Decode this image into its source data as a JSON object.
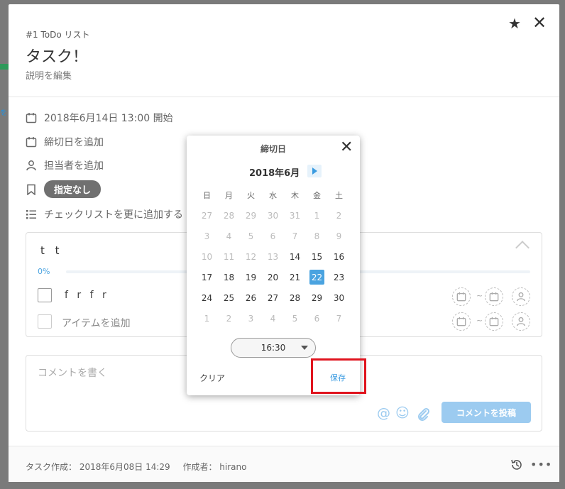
{
  "header": {
    "breadcrumb": "#1 ToDo リスト",
    "title": "タスク！",
    "description": "説明を編集"
  },
  "details": {
    "start": "2018年6月14日 13:00 開始",
    "due": "締切日を追加",
    "assignee": "担当者を追加",
    "label": "指定なし",
    "checklist_add": "チェックリストを更に追加する"
  },
  "checklist": {
    "title": "t t",
    "progress_text": "0%",
    "progress": 0,
    "items": [
      {
        "text": "f r f r"
      }
    ],
    "add_item": "アイテムを追加",
    "tilde": "~"
  },
  "comment": {
    "placeholder": "コメントを書く",
    "post_button": "コメントを投稿"
  },
  "footer": {
    "created": "タスク作成： 2018年6月08日 14:29",
    "author": "作成者： hirano"
  },
  "datepicker": {
    "title": "締切日",
    "month": "2018年6月",
    "weekdays": [
      "日",
      "月",
      "火",
      "水",
      "木",
      "金",
      "土"
    ],
    "weeks": [
      [
        [
          "27",
          0
        ],
        [
          "28",
          0
        ],
        [
          "29",
          0
        ],
        [
          "30",
          0
        ],
        [
          "31",
          0
        ],
        [
          "1",
          0
        ],
        [
          "2",
          0
        ]
      ],
      [
        [
          "3",
          0
        ],
        [
          "4",
          0
        ],
        [
          "5",
          0
        ],
        [
          "6",
          0
        ],
        [
          "7",
          0
        ],
        [
          "8",
          0
        ],
        [
          "9",
          0
        ]
      ],
      [
        [
          "10",
          0
        ],
        [
          "11",
          0
        ],
        [
          "12",
          0
        ],
        [
          "13",
          0
        ],
        [
          "14",
          1
        ],
        [
          "15",
          1
        ],
        [
          "16",
          1
        ]
      ],
      [
        [
          "17",
          1
        ],
        [
          "18",
          1
        ],
        [
          "19",
          1
        ],
        [
          "20",
          1
        ],
        [
          "21",
          1
        ],
        [
          "22",
          2
        ],
        [
          "23",
          1
        ]
      ],
      [
        [
          "24",
          1
        ],
        [
          "25",
          1
        ],
        [
          "26",
          1
        ],
        [
          "27",
          1
        ],
        [
          "28",
          1
        ],
        [
          "29",
          1
        ],
        [
          "30",
          1
        ]
      ],
      [
        [
          "1",
          0
        ],
        [
          "2",
          0
        ],
        [
          "3",
          0
        ],
        [
          "4",
          0
        ],
        [
          "5",
          0
        ],
        [
          "6",
          0
        ],
        [
          "7",
          0
        ]
      ]
    ],
    "time": "16:30",
    "clear": "クリア",
    "save": "保存"
  },
  "icons": {
    "star": "star-icon",
    "close": "close-icon",
    "calendar": "calendar-icon",
    "person": "person-icon",
    "bookmark": "bookmark-icon",
    "list": "list-icon",
    "mention": "at-icon",
    "emoji": "smile-icon",
    "attach": "paperclip-icon",
    "history": "history-icon",
    "more": "more-icon"
  },
  "colors": {
    "accent": "#4aa3e0",
    "post_button": "#9ccbf0",
    "label_pill": "#707070",
    "highlight_box": "#e0141e"
  }
}
